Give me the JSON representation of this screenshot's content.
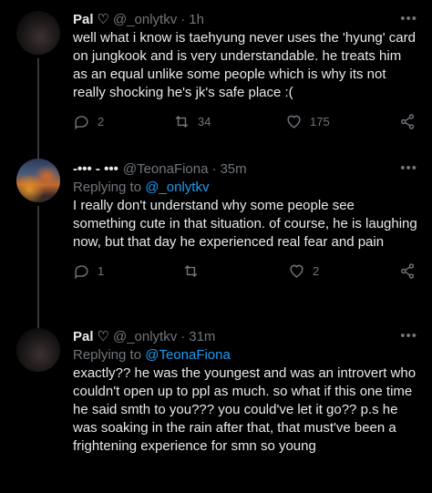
{
  "tweets": [
    {
      "name": "Pal",
      "name_icon": "heart-outline-icon",
      "handle": "@_onlytkv",
      "time": "1h",
      "text": "well what i know is taehyung never uses the 'hyung' card on jungkook and is very understandable. he treats him as an equal unlike some people which is why its not really shocking he's jk's safe place :(",
      "replies": "2",
      "retweets": "34",
      "likes": "175"
    },
    {
      "name": "-••• - •••",
      "handle": "@TeonaFiona",
      "time": "35m",
      "reply_prefix": "Replying to",
      "reply_target": "@_onlytkv",
      "text": "I really don't understand why some people see something cute in that situation. of course, he is laughing now, but that day he experienced real fear and pain",
      "replies": "1",
      "retweets": "",
      "likes": "2"
    },
    {
      "name": "Pal",
      "name_icon": "heart-outline-icon",
      "handle": "@_onlytkv",
      "time": "31m",
      "reply_prefix": "Replying to",
      "reply_target": "@TeonaFiona",
      "text": "exactly?? he was the youngest and was an introvert who couldn't open up to ppl as much. so what if this one time he said smth to you??? you could've let it go?? p.s he was soaking in the rain after that, that must've been a frightening experience for smn so young"
    }
  ],
  "more_label": "•••",
  "separator": "·",
  "colors": {
    "background": "#000000",
    "text": "#e7e9ea",
    "muted": "#71767b",
    "link": "#1d9bf0"
  }
}
